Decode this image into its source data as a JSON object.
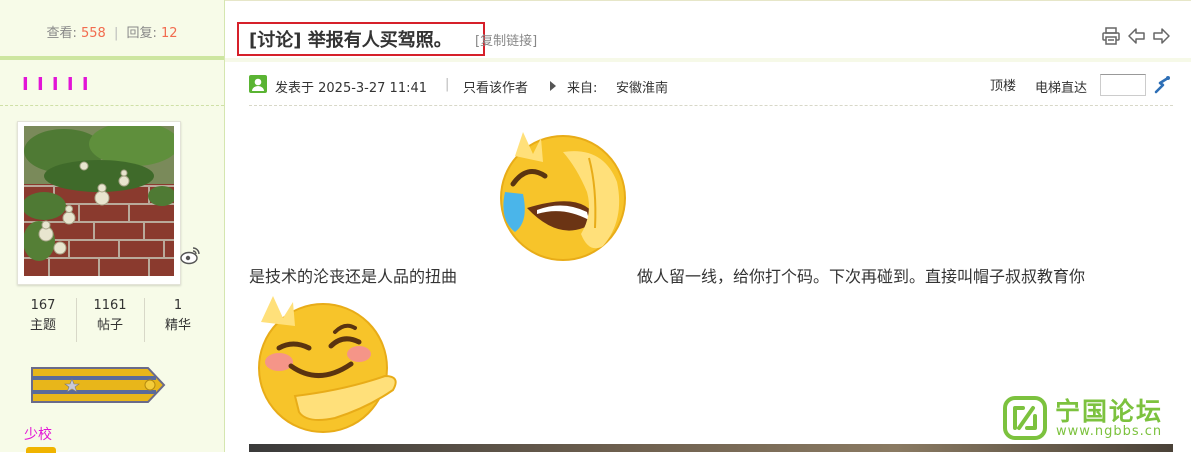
{
  "sidebar": {
    "views_label": "查看:",
    "views_value": "558",
    "replies_label": "回复:",
    "replies_value": "12",
    "stats_separator": "|",
    "username": "I I I I I",
    "user_stats": [
      {
        "value": "167",
        "label": "主题"
      },
      {
        "value": "1161",
        "label": "帖子"
      },
      {
        "value": "1",
        "label": "精华"
      }
    ],
    "rank": "少校"
  },
  "thread": {
    "title": "[讨论] 举报有人买驾照。",
    "copy_link": "[复制链接]"
  },
  "post_meta": {
    "posted_at": "发表于 2025-3-27 11:41",
    "separator": "|",
    "author_only": "只看该作者",
    "from_label": "来自:",
    "location": "安徽淮南",
    "top_floor": "顶楼",
    "goto_floor": "电梯直达",
    "goto_value": ""
  },
  "post": {
    "text_before": "是技术的沦丧还是人品的扭曲",
    "text_after": "做人留一线，给你打个码。下次再碰到。直接叫帽子叔叔教育你"
  },
  "watermark": {
    "title": "宁国论坛",
    "url": "www.ngbbs.cn"
  },
  "icons": [
    "print-icon",
    "prev-arrow-icon",
    "next-arrow-icon",
    "online-status-icon",
    "weibo-icon",
    "goto-floor-icon",
    "laughing-crying-emoji",
    "smirk-emoji",
    "rank-badge-icon"
  ],
  "colors": {
    "accent_green": "#7cc23e",
    "highlight_number": "#f26c4f",
    "username_magenta": "#e214d6",
    "title_box_red": "#d6202a"
  }
}
